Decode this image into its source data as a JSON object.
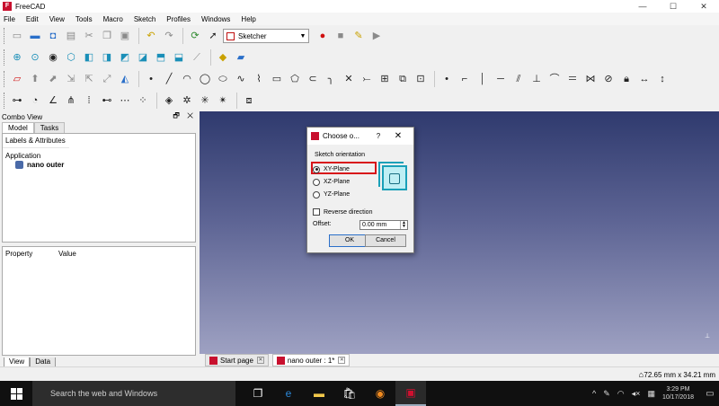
{
  "window": {
    "title": "FreeCAD",
    "controls": [
      "—",
      "☐",
      "✕"
    ]
  },
  "menu": [
    "File",
    "Edit",
    "View",
    "Tools",
    "Macro",
    "Sketch",
    "Profiles",
    "Windows",
    "Help"
  ],
  "toolbar": {
    "workbench": "Sketcher"
  },
  "combo": {
    "title": "Combo View",
    "controls": "🗗 ✕",
    "tabs": [
      "Model",
      "Tasks"
    ],
    "tree_header": "Labels & Attributes",
    "application_label": "Application",
    "document_name": "nano outer",
    "property_columns": [
      "Property",
      "Value"
    ],
    "bottom_tabs": [
      "View",
      "Data"
    ]
  },
  "doc_tabs": [
    {
      "label": "Start page"
    },
    {
      "label": "nano outer : 1*"
    }
  ],
  "status": {
    "coords": "72.65 mm x 34.21 mm"
  },
  "dialog": {
    "title": "Choose o...",
    "help": "?",
    "close": "✕",
    "group_label": "Sketch orientation",
    "options": [
      "XY-Plane",
      "XZ-Plane",
      "YZ-Plane"
    ],
    "selected": "XY-Plane",
    "reverse_label": "Reverse direction",
    "offset_label": "Offset:",
    "offset_value": "0.00 mm",
    "ok_label": "OK",
    "cancel_label": "Cancel"
  },
  "taskbar": {
    "search_placeholder": "Search the web and Windows",
    "time": "3:29 PM",
    "date": "10/17/2018"
  },
  "colors": {
    "accent_red": "#d8141a",
    "view_top": "#2f3a6e",
    "view_bottom": "#9ea1c2",
    "plane_icon": "#1aa0b8"
  }
}
